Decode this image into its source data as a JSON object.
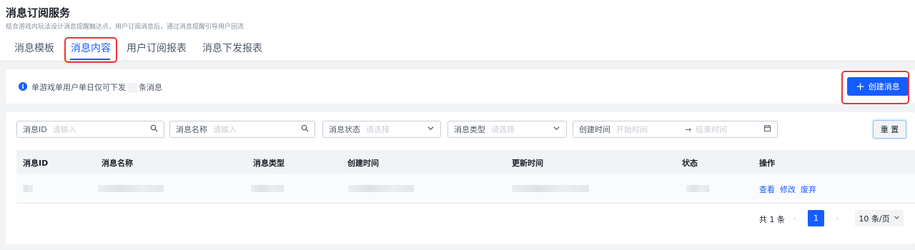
{
  "header": {
    "title": "消息订阅服务",
    "subtitle": "结合游戏内玩法设计消息提醒触达点，用户订阅消息后，通过消息提醒引导用户回流",
    "tabs": [
      {
        "label": "消息模板"
      },
      {
        "label": "消息内容"
      },
      {
        "label": "用户订阅报表"
      },
      {
        "label": "消息下发报表"
      }
    ],
    "active_tab": 1
  },
  "notice": {
    "icon": "info-icon",
    "icon_glyph": "i",
    "text_before": "单游戏单用户单日仅可下发",
    "text_after": "条消息"
  },
  "create_button": {
    "icon": "plus-icon",
    "glyph": "+",
    "label": "创建消息"
  },
  "filters": {
    "id": {
      "label": "消息ID",
      "placeholder": "请输入",
      "icon": "search-icon"
    },
    "name": {
      "label": "消息名称",
      "placeholder": "请输入",
      "icon": "search-icon"
    },
    "status": {
      "label": "消息状态",
      "placeholder": "请选择",
      "icon": "chevron-down-icon"
    },
    "type": {
      "label": "消息类型",
      "placeholder": "请选择",
      "icon": "chevron-down-icon"
    },
    "time": {
      "label": "创建时间",
      "start_placeholder": "开始时间",
      "arrow": "→",
      "end_placeholder": "结束时间",
      "icon": "calendar-icon"
    }
  },
  "reset_button": {
    "label": "重 置"
  },
  "table": {
    "columns": [
      "消息ID",
      "消息名称",
      "消息类型",
      "创建时间",
      "更新时间",
      "状态",
      "操作"
    ],
    "row_actions": [
      "查看",
      "修改",
      "废弃"
    ]
  },
  "pagination": {
    "total": "共 1 条",
    "prev": "‹",
    "current": "1",
    "next": "›",
    "page_size": "10 条/页",
    "page_size_icon": "chevron-down-icon"
  },
  "colors": {
    "accent": "#165dff",
    "highlight_box": "#e8363b"
  }
}
